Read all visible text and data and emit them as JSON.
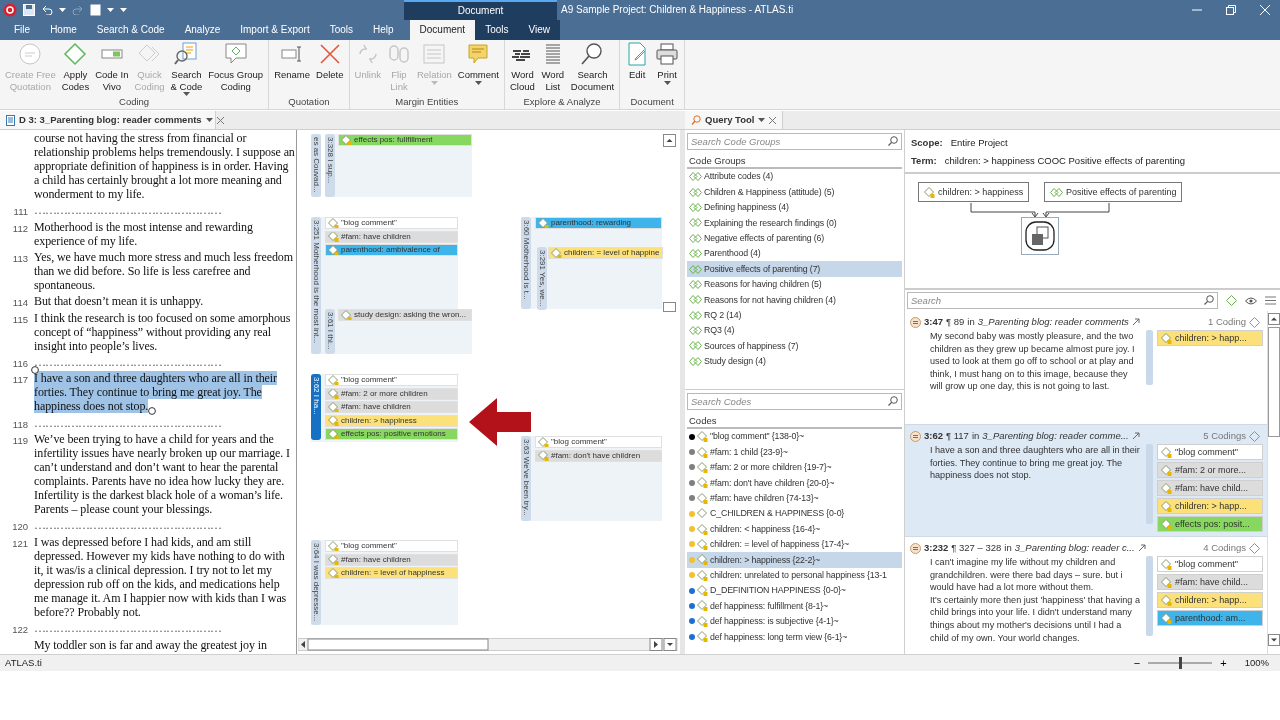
{
  "title_bar": {
    "context_label": "Document",
    "title": "A9 Sample Project: Children & Happiness - ATLAS.ti"
  },
  "ribbon_tabs": [
    {
      "label": "File",
      "selected": false,
      "contextual": false
    },
    {
      "label": "Home",
      "selected": false,
      "contextual": false
    },
    {
      "label": "Search & Code",
      "selected": false,
      "contextual": false
    },
    {
      "label": "Analyze",
      "selected": false,
      "contextual": false
    },
    {
      "label": "Import & Export",
      "selected": false,
      "contextual": false
    },
    {
      "label": "Tools",
      "selected": false,
      "contextual": false
    },
    {
      "label": "Help",
      "selected": false,
      "contextual": false
    },
    {
      "label": "Document",
      "selected": true,
      "contextual": true
    },
    {
      "label": "Tools",
      "selected": false,
      "contextual": true
    },
    {
      "label": "View",
      "selected": false,
      "contextual": true
    }
  ],
  "ribbon_groups": [
    {
      "label": "Coding",
      "buttons": [
        {
          "label": "Create Free\nQuotation",
          "disabled": true,
          "dropdown": false
        },
        {
          "label": "Apply\nCodes",
          "disabled": false,
          "dropdown": false
        },
        {
          "label": "Code In\nVivo",
          "disabled": false,
          "dropdown": false
        },
        {
          "label": "Quick\nCoding",
          "disabled": true,
          "dropdown": false
        },
        {
          "label": "Search\n& Code",
          "disabled": false,
          "dropdown": true
        },
        {
          "label": "Focus Group\nCoding",
          "disabled": false,
          "dropdown": false
        }
      ]
    },
    {
      "label": "Quotation",
      "buttons": [
        {
          "label": "Rename",
          "disabled": false,
          "dropdown": false
        },
        {
          "label": "Delete",
          "disabled": false,
          "dropdown": false
        }
      ]
    },
    {
      "label": "Margin Entities",
      "buttons": [
        {
          "label": "Unlink",
          "disabled": true,
          "dropdown": false
        },
        {
          "label": "Flip\nLink",
          "disabled": true,
          "dropdown": false
        },
        {
          "label": "Relation",
          "disabled": true,
          "dropdown": true
        },
        {
          "label": "Comment",
          "disabled": false,
          "dropdown": true
        }
      ]
    },
    {
      "label": "Explore & Analyze",
      "buttons": [
        {
          "label": "Word\nCloud",
          "disabled": false,
          "dropdown": false
        },
        {
          "label": "Word\nList",
          "disabled": false,
          "dropdown": false
        },
        {
          "label": "Search\nDocument",
          "disabled": false,
          "dropdown": false
        }
      ]
    },
    {
      "label": "Document",
      "buttons": [
        {
          "label": "Edit",
          "disabled": false,
          "dropdown": false
        },
        {
          "label": "Print",
          "disabled": false,
          "dropdown": true
        }
      ]
    }
  ],
  "document_tab": {
    "label": "D 3: 3_Parenting blog: reader comments"
  },
  "document": {
    "paragraphs": [
      {
        "kind": "text",
        "text": "course not having the stress from financial or relationship problems helps tremendously. I suppose an appropriate definition of happiness is in order. Having a child has certainly brought a lot more meaning and wonderment to my life.",
        "selected": false
      },
      {
        "number": "111",
        "kind": "separator",
        "text": "……………………………………………",
        "selected": false
      },
      {
        "number": "112",
        "kind": "text",
        "text": "Motherhood is the most intense and rewarding experience of my life.",
        "selected": false
      },
      {
        "number": "113",
        "kind": "text",
        "text": "Yes, we have much more stress and much less freedom than we did before. So life is less carefree and spontaneous.",
        "selected": false
      },
      {
        "number": "114",
        "kind": "text",
        "text": "But that doesn’t mean it is unhappy.",
        "selected": false
      },
      {
        "number": "115",
        "kind": "text",
        "text": "I think the research is too focused on some amorphous concept of “happiness” without providing any real insight into people’s lives.",
        "selected": false
      },
      {
        "number": "116",
        "kind": "separator",
        "text": "……………………………………………",
        "selected": false
      },
      {
        "number": "117",
        "kind": "text",
        "text": "I have a son and three daughters who are all in their forties. They continue to bring me great joy. The happiness does not stop.",
        "selected": true
      },
      {
        "number": "118",
        "kind": "separator",
        "text": "……………………………………………",
        "selected": false
      },
      {
        "number": "119",
        "kind": "text",
        "text": "We’ve been trying to have a child for years and the infertility issues have nearly broken up our marriage. I can’t understand and don’t want to hear the parental complaints. Parents have no idea how lucky they are. Infertility is the darkest black hole of a woman’s life. Parents – please count your blessings.",
        "selected": false
      },
      {
        "number": "120",
        "kind": "separator",
        "text": "……………………………………………",
        "selected": false
      },
      {
        "number": "121",
        "kind": "text",
        "text": "I was depressed before I had kids, and am still depressed. However my kids have nothing to do with it, it was/is a clinical depression. I try not to let my depression rub off on the kids, and medications help me manage it. Am I happier now with kids than I was before?? Probably not.",
        "selected": false
      },
      {
        "number": "122",
        "kind": "separator",
        "text": "……………………………………………",
        "selected": false
      },
      {
        "kind": "text",
        "text": "My toddler son is far and away the greatest joy in",
        "selected": false
      }
    ]
  },
  "margin": {
    "quotations": [
      {
        "label": "es as Couvad...",
        "selected": false
      },
      {
        "label": "3:328 I sup...",
        "selected": false,
        "codes": [
          {
            "name": "effects pos: fullfillment",
            "color": "#86d95e"
          }
        ]
      },
      {
        "label": "3:251 Motherhood is the most int...",
        "selected": false,
        "codes": [
          {
            "name": "\"blog comment\"",
            "color": "#ffffff"
          },
          {
            "name": "#fam: have children",
            "color": "#dcdcdc"
          },
          {
            "name": "parenthood: ambivalence of",
            "color": "#3fb4ea"
          }
        ]
      },
      {
        "label": "3:61 I thi...",
        "selected": false,
        "codes": [
          {
            "name": "study design: asking the wron...",
            "color": "#dcdcdc"
          }
        ]
      },
      {
        "label": "3:60 Motherhood is t...",
        "selected": false,
        "codes": [
          {
            "name": "parenthood: rewarding",
            "color": "#3fb4ea"
          }
        ]
      },
      {
        "label": "3:291 Yes, we...",
        "selected": false,
        "codes": [
          {
            "name": "children: = level of happine",
            "color": "#fce17a"
          }
        ]
      },
      {
        "label": "3:62 I ha...",
        "selected": true,
        "codes": [
          {
            "name": "\"blog comment\"",
            "color": "#ffffff"
          },
          {
            "name": "#fam: 2 or more  children",
            "color": "#dcdcdc"
          },
          {
            "name": "#fam: have children",
            "color": "#dcdcdc"
          },
          {
            "name": "children: > happiness",
            "color": "#fce17a"
          },
          {
            "name": "effects pos: positive emotions",
            "color": "#86d95e"
          }
        ]
      },
      {
        "label": "3:63 We've been try...",
        "selected": false,
        "codes": [
          {
            "name": "\"blog comment\"",
            "color": "#ffffff"
          },
          {
            "name": "#fam: don't have children",
            "color": "#dcdcdc"
          }
        ]
      },
      {
        "label": "3:64 I was depresse...",
        "selected": false,
        "codes": [
          {
            "name": "\"blog comment\"",
            "color": "#ffffff"
          },
          {
            "name": "#fam: have children",
            "color": "#dcdcdc"
          },
          {
            "name": "children: = level of happiness",
            "color": "#fce17a"
          }
        ]
      }
    ]
  },
  "query_tab": {
    "label": "Query Tool"
  },
  "code_groups": {
    "search_placeholder": "Search Code Groups",
    "header": "Code Groups",
    "items": [
      {
        "label": "Attribute codes (4)",
        "selected": false
      },
      {
        "label": "Children & Happiness (attitude) (5)",
        "selected": false
      },
      {
        "label": "Defining happiness (4)",
        "selected": false
      },
      {
        "label": "Explaining the research findings (0)",
        "selected": false
      },
      {
        "label": "Negative effects of parenting (6)",
        "selected": false
      },
      {
        "label": "Parenthood (4)",
        "selected": false
      },
      {
        "label": "Positive effects of parenting (7)",
        "selected": true
      },
      {
        "label": "Reasons for having children (5)",
        "selected": false
      },
      {
        "label": "Reasons for not having children (4)",
        "selected": false
      },
      {
        "label": "RQ 2 (14)",
        "selected": false
      },
      {
        "label": "RQ3 (4)",
        "selected": false
      },
      {
        "label": "Sources of happiness (7)",
        "selected": false
      },
      {
        "label": "Study design (4)",
        "selected": false
      }
    ]
  },
  "codes": {
    "search_placeholder": "Search Codes",
    "header": "Codes",
    "items": [
      {
        "label": "\"blog comment\" {138-0}~",
        "color": "#000000",
        "commented": true,
        "selected": false
      },
      {
        "label": "#fam: 1 child {23-9}~",
        "color": "#7f7f7f",
        "commented": true,
        "selected": false
      },
      {
        "label": "#fam: 2 or more  children {19-7}~",
        "color": "#7f7f7f",
        "commented": true,
        "selected": false
      },
      {
        "label": "#fam: don't have children {20-0}~",
        "color": "#7f7f7f",
        "commented": true,
        "selected": false
      },
      {
        "label": "#fam: have children {74-13}~",
        "color": "#7f7f7f",
        "commented": true,
        "selected": false
      },
      {
        "label": "C_CHILDREN & HAPPINESS {0-0}",
        "color": "#f2c12e",
        "commented": false,
        "selected": false
      },
      {
        "label": "children: < happiness {16-4}~",
        "color": "#f2c12e",
        "commented": true,
        "selected": false
      },
      {
        "label": "children: = level of happiness {17-4}~",
        "color": "#f2c12e",
        "commented": true,
        "selected": false
      },
      {
        "label": "children: > happiness {22-2}~",
        "color": "#f2c12e",
        "commented": true,
        "selected": true
      },
      {
        "label": "children: unrelated to personal happiness {13-1",
        "color": "#f2c12e",
        "commented": true,
        "selected": false
      },
      {
        "label": "D_DEFINITION HAPPINESS {0-0}~",
        "color": "#1f6fd1",
        "commented": true,
        "selected": false
      },
      {
        "label": "def happiness: fulfillment {8-1}~",
        "color": "#1f6fd1",
        "commented": true,
        "selected": false
      },
      {
        "label": "def happiness: is subjective {4-1}~",
        "color": "#1f6fd1",
        "commented": true,
        "selected": false
      },
      {
        "label": "def happiness: long term view {6-1}~",
        "color": "#1f6fd1",
        "commented": true,
        "selected": false
      }
    ]
  },
  "query": {
    "scope_label": "Scope:",
    "scope": "Entire Project",
    "term_label": "Term:",
    "term": "children: > happiness COOC Positive effects of parenting",
    "operands": [
      {
        "label": "children: > happiness",
        "kind": "code"
      },
      {
        "label": "Positive effects of parenting",
        "kind": "group"
      }
    ]
  },
  "results": {
    "search_placeholder": "Search",
    "quotations": [
      {
        "id": "3:47",
        "paragraph": "¶ 89",
        "in": "in",
        "document": "3_Parenting blog: reader comments",
        "codings": "1 Coding",
        "selected": false,
        "text": "My second baby was mostly pleasure, and the two children as they grew up became almost pure joy. I used to look at them go off to school or at play and think, I must hang on to this image, because they will grow up one day, this is not going to last.",
        "codes": [
          {
            "name": "children: > happ...",
            "color": "#fce17a"
          }
        ]
      },
      {
        "id": "3:62",
        "paragraph": "¶ 117",
        "in": "in",
        "document": "3_Parenting blog: reader comme...",
        "codings": "5 Codings",
        "selected": true,
        "text": "I have a son and three daughters who are all in their forties. They continue to bring me great joy. The happiness does not stop.",
        "codes": [
          {
            "name": "\"blog comment\"",
            "color": "#ffffff"
          },
          {
            "name": "#fam: 2 or more...",
            "color": "#dcdcdc"
          },
          {
            "name": "#fam: have child...",
            "color": "#dcdcdc"
          },
          {
            "name": "children: > happ...",
            "color": "#fce17a"
          },
          {
            "name": "effects pos: posit...",
            "color": "#86d95e"
          }
        ]
      },
      {
        "id": "3:232",
        "paragraph": "¶ 327 – 328",
        "in": "in",
        "document": "3_Parenting blog: reader c...",
        "codings": "4 Codings",
        "selected": false,
        "text": "I can't imagine my life without my children and grandchildren. were there bad days – sure. but i would have had a lot more without them.\nIt's certainly more then just 'happiness' that having a child brings into your life. I didn't understand many things about my mother's decisions until I had a child of my own. Your world changes.",
        "codes": [
          {
            "name": "\"blog comment\"",
            "color": "#ffffff"
          },
          {
            "name": "#fam: have child...",
            "color": "#dcdcdc"
          },
          {
            "name": "children: > happ...",
            "color": "#fce17a"
          },
          {
            "name": "parenthood: am...",
            "color": "#3fb4ea"
          }
        ]
      }
    ]
  },
  "status_bar": {
    "app": "ATLAS.ti",
    "zoom_out": "−",
    "zoom_in": "+",
    "zoom": {
      "level": 0.5
    },
    "zoom_reading": "100%"
  }
}
